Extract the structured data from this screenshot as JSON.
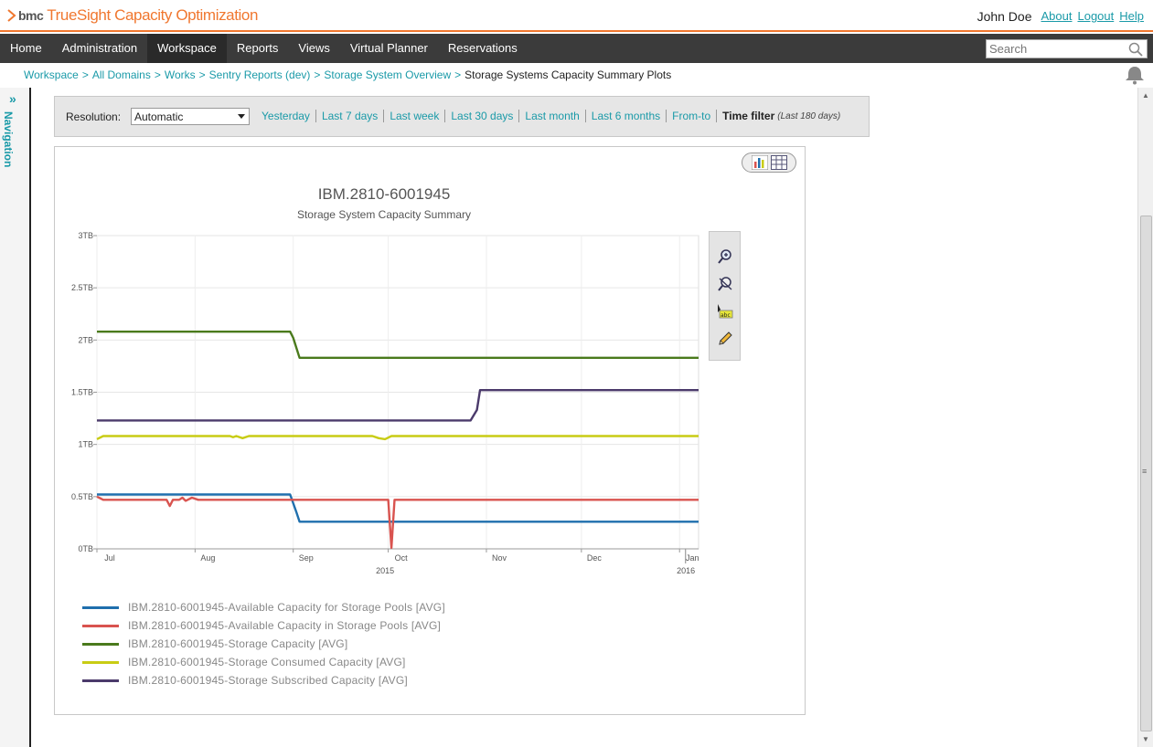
{
  "header": {
    "brand": "bmc",
    "product": "TrueSight Capacity Optimization",
    "user": "John Doe",
    "links": [
      "About",
      "Logout",
      "Help"
    ]
  },
  "nav": {
    "items": [
      "Home",
      "Administration",
      "Workspace",
      "Reports",
      "Views",
      "Virtual Planner",
      "Reservations"
    ],
    "active": "Workspace",
    "search_placeholder": "Search"
  },
  "breadcrumb": {
    "items": [
      "Workspace",
      "All Domains",
      "Works",
      "Sentry Reports (dev)",
      "Storage System Overview"
    ],
    "current": "Storage Systems Capacity Summary Plots"
  },
  "leftnav": {
    "label": "Navigation"
  },
  "filter": {
    "resolution_label": "Resolution:",
    "resolution_value": "Automatic",
    "ranges": [
      "Yesterday",
      "Last 7 days",
      "Last week",
      "Last 30 days",
      "Last month",
      "Last 6 months",
      "From-to"
    ],
    "time_filter_label": "Time filter",
    "time_filter_note": "(Last 180 days)"
  },
  "chart_data": {
    "type": "line",
    "title": "IBM.2810-6001945",
    "subtitle": "Storage System Capacity Summary",
    "ylabel": "",
    "xlabel": "",
    "y_ticks": [
      "0TB",
      "0.5TB",
      "1TB",
      "1.5TB",
      "2TB",
      "2.5TB",
      "3TB"
    ],
    "ylim": [
      0,
      3
    ],
    "x_ticks": [
      "Jul",
      "Aug",
      "Sep",
      "Oct",
      "Nov",
      "Dec",
      "Jan"
    ],
    "x_year_labels": [
      "2015",
      "2016"
    ],
    "x_domain": [
      "2015-07-01",
      "2016-01-07"
    ],
    "series": [
      {
        "name": "IBM.2810-6001945-Available Capacity for Storage Pools [AVG]",
        "color": "#1f6fad",
        "points": [
          [
            "2015-07-01",
            0.52
          ],
          [
            "2015-08-31",
            0.52
          ],
          [
            "2015-09-02",
            0.35
          ],
          [
            "2015-09-03",
            0.26
          ],
          [
            "2016-01-07",
            0.26
          ]
        ]
      },
      {
        "name": "IBM.2810-6001945-Available Capacity in Storage Pools [AVG]",
        "color": "#d9534f",
        "points": [
          [
            "2015-07-01",
            0.5
          ],
          [
            "2015-07-03",
            0.47
          ],
          [
            "2015-07-23",
            0.47
          ],
          [
            "2015-07-24",
            0.41
          ],
          [
            "2015-07-25",
            0.47
          ],
          [
            "2015-07-27",
            0.47
          ],
          [
            "2015-07-28",
            0.49
          ],
          [
            "2015-07-29",
            0.46
          ],
          [
            "2015-07-31",
            0.49
          ],
          [
            "2015-08-02",
            0.47
          ],
          [
            "2015-08-04",
            0.47
          ],
          [
            "2015-10-01",
            0.47
          ],
          [
            "2015-10-02",
            0.01
          ],
          [
            "2015-10-03",
            0.47
          ],
          [
            "2016-01-07",
            0.47
          ]
        ]
      },
      {
        "name": "IBM.2810-6001945-Storage Capacity [AVG]",
        "color": "#4a7a1c",
        "points": [
          [
            "2015-07-01",
            2.08
          ],
          [
            "2015-08-31",
            2.08
          ],
          [
            "2015-09-01",
            2.02
          ],
          [
            "2015-09-03",
            1.83
          ],
          [
            "2016-01-07",
            1.83
          ]
        ]
      },
      {
        "name": "IBM.2810-6001945-Storage Consumed Capacity [AVG]",
        "color": "#c8cc14",
        "points": [
          [
            "2015-07-01",
            1.05
          ],
          [
            "2015-07-03",
            1.08
          ],
          [
            "2015-08-12",
            1.08
          ],
          [
            "2015-08-13",
            1.07
          ],
          [
            "2015-08-14",
            1.08
          ],
          [
            "2015-08-16",
            1.06
          ],
          [
            "2015-08-18",
            1.08
          ],
          [
            "2015-09-26",
            1.08
          ],
          [
            "2015-09-28",
            1.06
          ],
          [
            "2015-09-30",
            1.05
          ],
          [
            "2015-10-02",
            1.08
          ],
          [
            "2016-01-07",
            1.08
          ]
        ]
      },
      {
        "name": "IBM.2810-6001945-Storage Subscribed Capacity [AVG]",
        "color": "#4b3a6b",
        "points": [
          [
            "2015-07-01",
            1.23
          ],
          [
            "2015-10-27",
            1.23
          ],
          [
            "2015-10-29",
            1.33
          ],
          [
            "2015-10-30",
            1.52
          ],
          [
            "2016-01-07",
            1.52
          ]
        ]
      }
    ],
    "grid": true,
    "legend_position": "bottom"
  }
}
